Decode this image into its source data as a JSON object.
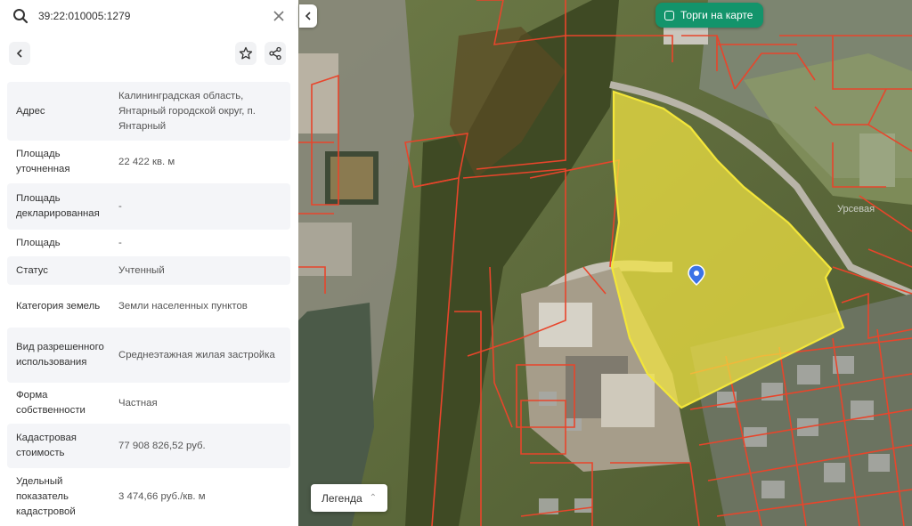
{
  "search": {
    "query": "39:22:010005:1279"
  },
  "icons": {
    "search": "search-icon",
    "clear": "close-icon",
    "back": "chevron-left-icon",
    "favorite": "star-icon",
    "share": "share-icon",
    "collapse": "chevron-left-icon",
    "marker": "map-pin-icon"
  },
  "properties": [
    {
      "label": "Адрес",
      "value": "Калининградская область, Янтарный городской округ, п. Янтарный"
    },
    {
      "label": "Площадь уточненная",
      "value": "22 422 кв. м"
    },
    {
      "label": "Площадь декларированная",
      "value": "-"
    },
    {
      "label": "Площадь",
      "value": "-"
    },
    {
      "label": "Статус",
      "value": "Учтенный"
    },
    {
      "label": "Категория земель",
      "value": "Земли населенных пунктов"
    },
    {
      "label": "Вид разрешенного использования",
      "value": "Среднеэтажная жилая застройка"
    },
    {
      "label": "Форма собственности",
      "value": "Частная"
    },
    {
      "label": "Кадастровая стоимость",
      "value": "77 908 826,52 руб."
    },
    {
      "label": "Удельный показатель кадастровой",
      "value": "3 474,66 руб./кв. м"
    }
  ],
  "map": {
    "auction_toggle": {
      "label": "Торги на карте",
      "checked": false
    },
    "legend_label": "Легенда",
    "street_label": "Урсевая",
    "colors": {
      "parcel_line": "#e8452b",
      "selected_fill": "#f2e541",
      "selected_line": "#f3e63a",
      "marker": "#3b73e6",
      "accent": "#13946b"
    }
  }
}
